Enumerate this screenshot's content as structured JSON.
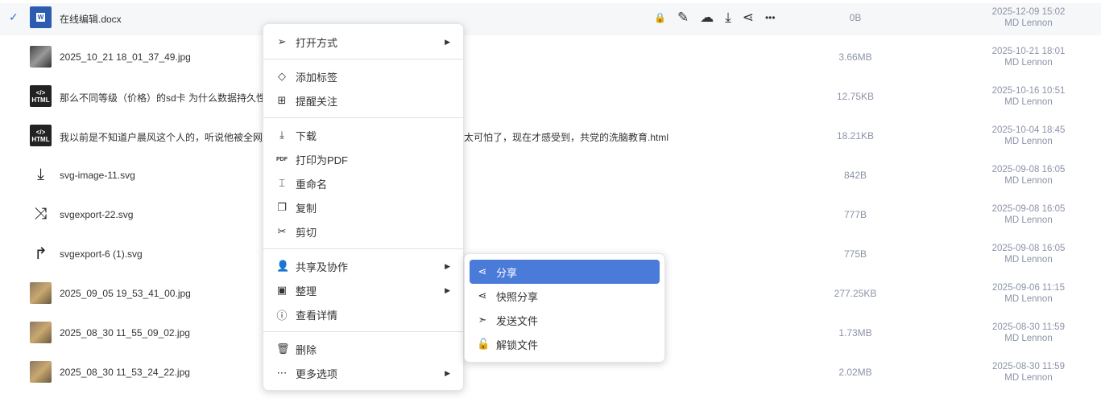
{
  "files": [
    {
      "name": "在线编辑.docx",
      "size": "0B",
      "date": "2025-12-09 15:02",
      "user": "MD Lennon",
      "icon": "word-icon"
    },
    {
      "name": "2025_10_21 18_01_37_49.jpg",
      "size": "3.66MB",
      "date": "2025-10-21 18:01",
      "user": "MD Lennon",
      "icon": "photo-thumbnail"
    },
    {
      "name": "那么不同等级（价格）的sd卡 为什么数据持久性和",
      "size": "12.75KB",
      "date": "2025-10-16 10:51",
      "user": "MD Lennon",
      "icon": "html-icon"
    },
    {
      "name": "我以前是不知道户晨风这个人的，听说他被全网封杀",
      "name_tail": "太可怕了，现在才感受到，共党的洗脑教育.html",
      "size": "18.21KB",
      "date": "2025-10-04 18:45",
      "user": "MD Lennon",
      "icon": "html-icon"
    },
    {
      "name": "svg-image-11.svg",
      "size": "842B",
      "date": "2025-09-08 16:05",
      "user": "MD Lennon",
      "icon": "download-icon"
    },
    {
      "name": "svgexport-22.svg",
      "size": "777B",
      "date": "2025-09-08 16:05",
      "user": "MD Lennon",
      "icon": "shuffle-icon"
    },
    {
      "name": "svgexport-6 (1).svg",
      "size": "775B",
      "date": "2025-09-08 16:05",
      "user": "MD Lennon",
      "icon": "share-arrow-icon"
    },
    {
      "name": "2025_09_05 19_53_41_00.jpg",
      "size": "277.25KB",
      "date": "2025-09-06 11:15",
      "user": "MD Lennon",
      "icon": "photo-thumbnail"
    },
    {
      "name": "2025_08_30 11_55_09_02.jpg",
      "size": "1.73MB",
      "date": "2025-08-30 11:59",
      "user": "MD Lennon",
      "icon": "photo-thumbnail"
    },
    {
      "name": "2025_08_30 11_53_24_22.jpg",
      "size": "2.02MB",
      "date": "2025-08-30 11:59",
      "user": "MD Lennon",
      "icon": "photo-thumbnail"
    }
  ],
  "icon_labels": {
    "word": "W",
    "html_tag": "</>",
    "html": "HTML"
  },
  "context_menu": {
    "open_with": "打开方式",
    "add_tag": "添加标签",
    "remind": "提醒关注",
    "download": "下载",
    "print_pdf": "打印为PDF",
    "pdf_icon": "PDF",
    "rename": "重命名",
    "copy": "复制",
    "cut": "剪切",
    "share_collab": "共享及协作",
    "organize": "整理",
    "details": "查看详情",
    "delete": "删除",
    "more": "更多选项"
  },
  "submenu": {
    "share": "分享",
    "snapshot_share": "快照分享",
    "send_file": "发送文件",
    "unlock_file": "解锁文件"
  },
  "colors": {
    "accent": "#4a7bd9",
    "lock": "#f0a93b",
    "meta": "#8c93a8"
  }
}
